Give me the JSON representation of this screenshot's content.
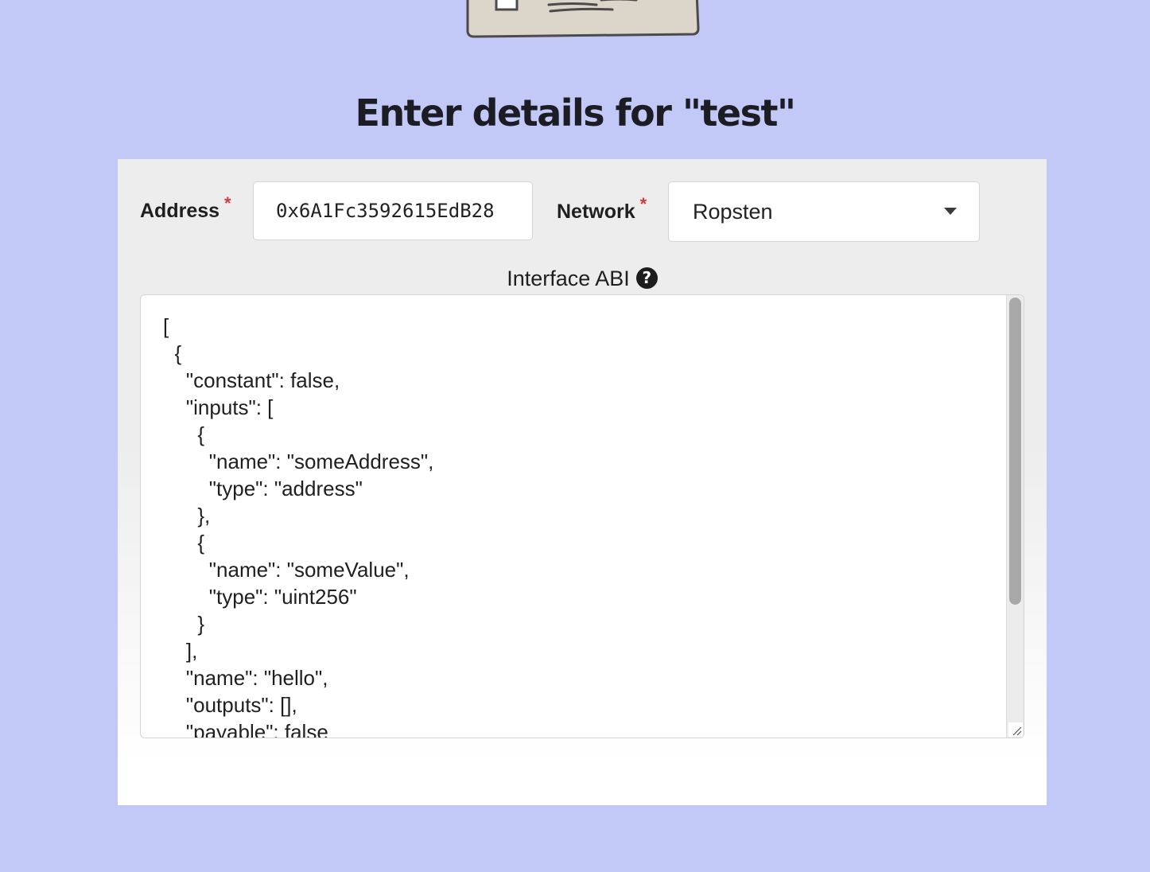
{
  "page": {
    "title": "Enter details for \"test\""
  },
  "form": {
    "address": {
      "label": "Address",
      "required_mark": "*",
      "value": "0x6A1Fc3592615EdB28"
    },
    "network": {
      "label": "Network",
      "required_mark": "*",
      "selected": "Ropsten"
    },
    "abi": {
      "label": "Interface ABI",
      "help_icon": "question-circle-icon",
      "value": "[\n  {\n    \"constant\": false,\n    \"inputs\": [\n      {\n        \"name\": \"someAddress\",\n        \"type\": \"address\"\n      },\n      {\n        \"name\": \"someValue\",\n        \"type\": \"uint256\"\n      }\n    ],\n    \"name\": \"hello\",\n    \"outputs\": [],\n    \"payable\": false"
    }
  },
  "colors": {
    "background": "#c3c9f7",
    "card": "#ededed",
    "required": "#d23b3b"
  }
}
